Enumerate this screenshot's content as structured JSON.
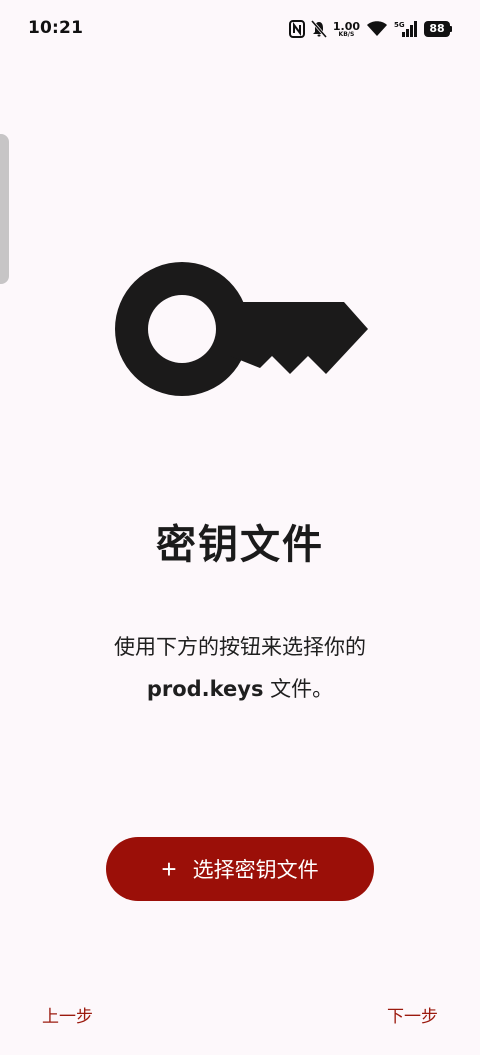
{
  "status_bar": {
    "time": "10:21",
    "net_speed_value": "1.00",
    "net_speed_unit": "KB/S",
    "network_type": "5G",
    "battery_level": "88",
    "icons": [
      "nfc-icon",
      "mute-icon",
      "net-speed",
      "wifi-icon",
      "signal-icon",
      "battery-icon"
    ]
  },
  "illustration": {
    "icon": "key-icon",
    "color": "#1b1a1a"
  },
  "main": {
    "title": "密钥文件",
    "description_line1": "使用下方的按钮来选择你的",
    "description_bold": "prod.keys",
    "description_suffix": " 文件。"
  },
  "action_button": {
    "icon": "plus-icon",
    "icon_glyph": "+",
    "label": "选择密钥文件",
    "color": "#9b0f08"
  },
  "navigation": {
    "prev_label": "上一步",
    "next_label": "下一步",
    "link_color": "#9b1a0e"
  }
}
